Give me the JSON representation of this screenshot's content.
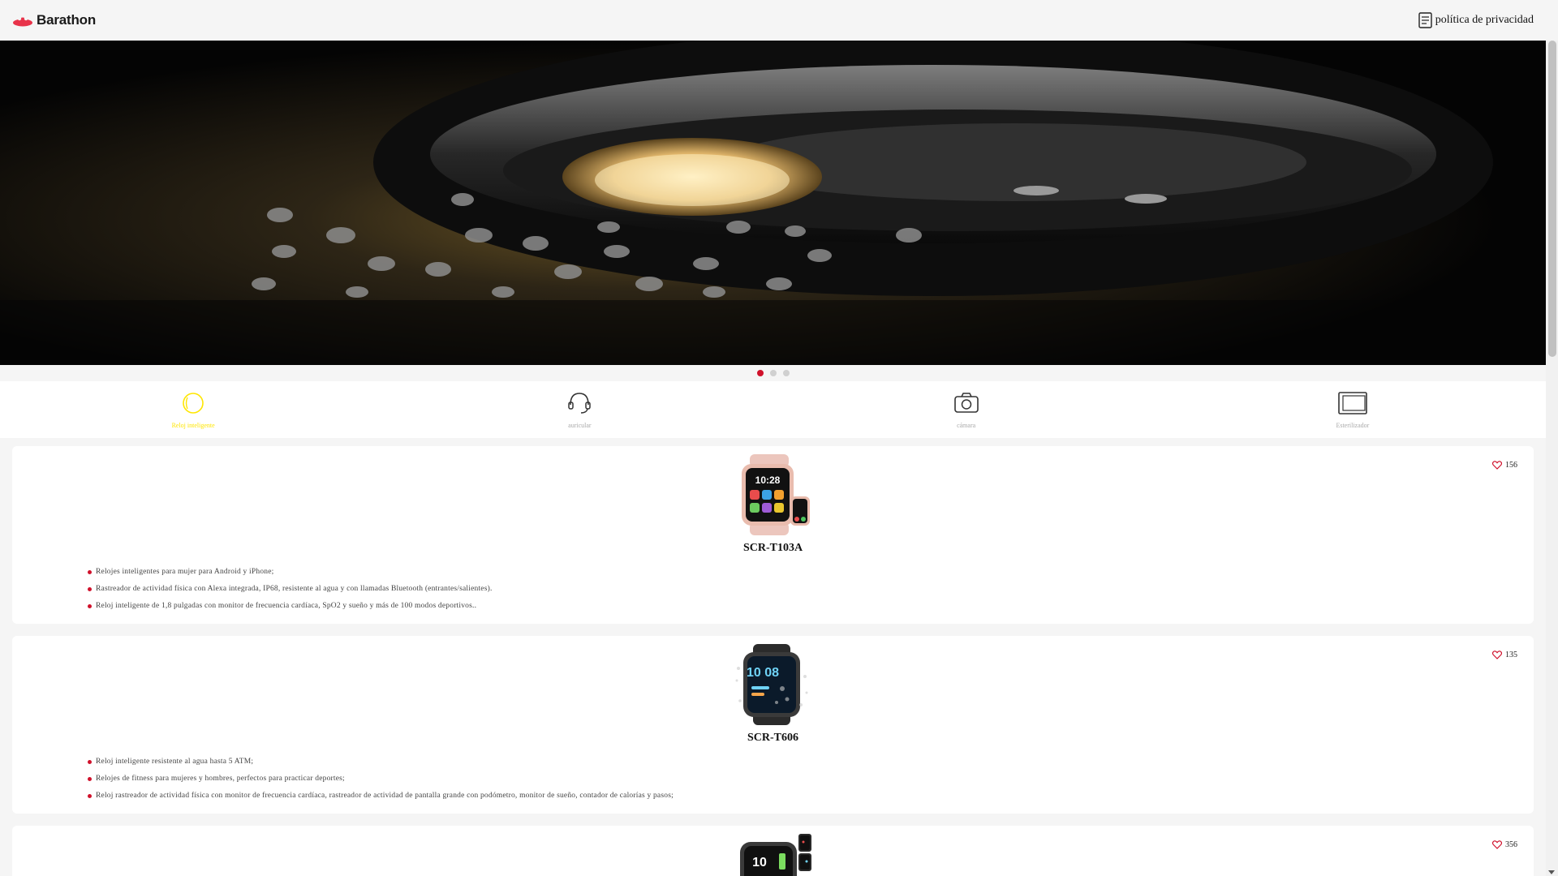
{
  "brand": {
    "name": "Barathon",
    "color": "#e8334a"
  },
  "header": {
    "privacy_label": "política de privacidad",
    "privacy_icon": "document-icon"
  },
  "carousel": {
    "total": 3,
    "active": 1,
    "active_color": "#d0112b"
  },
  "categories": [
    {
      "label": "Reloj inteligente",
      "icon": "smartwatch-icon",
      "active": true
    },
    {
      "label": "auricular",
      "icon": "headset-icon",
      "active": false
    },
    {
      "label": "cámara",
      "icon": "camera-icon",
      "active": false
    },
    {
      "label": "Esterilizador",
      "icon": "tablet-icon",
      "active": false
    }
  ],
  "products": [
    {
      "name": "SCR-T103A",
      "likes": "156",
      "features": [
        "Relojes inteligentes para mujer para Android y iPhone;",
        "Rastreador de actividad física con Alexa integrada, IP68, resistente al agua y con llamadas Bluetooth (entrantes/salientes).",
        "Reloj inteligente de 1,8 pulgadas con monitor de frecuencia cardíaca, SpO2 y sueño y más de 100 modos deportivos.."
      ],
      "watch_time": "10:28",
      "watch_color": "pink"
    },
    {
      "name": "SCR-T606",
      "likes": "135",
      "features": [
        "Reloj inteligente resistente al agua hasta 5 ATM;",
        "Relojes de fitness para mujeres y hombres, perfectos para practicar deportes;",
        "Reloj rastreador de actividad física con monitor de frecuencia cardíaca, rastreador de actividad de pantalla grande con podómetro, monitor de sueño, contador de calorías y pasos;"
      ],
      "watch_time": "10 08",
      "watch_color": "black"
    },
    {
      "name": "",
      "likes": "356",
      "features": [],
      "watch_time": "10",
      "watch_color": "black"
    }
  ]
}
